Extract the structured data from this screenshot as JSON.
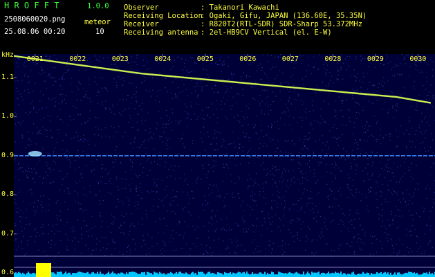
{
  "header": {
    "app_name": "H R O F F T",
    "version": "1.0.0",
    "filename": "2508060020.png",
    "meteor_label": "meteor",
    "datetime": "25.08.06 00:20",
    "meteor_count": "10",
    "labels": [
      "Observer",
      "Receiving Location",
      "Receiver",
      "Receiving antenna"
    ],
    "values": [
      ": Takanori Kawachi",
      ": Ogaki, Gifu, JAPAN (136.60E, 35.35N)",
      ": R820T2(RTL-SDR) SDR-Sharp 53.372MHz",
      ": 2el-HB9CV Vertical (el. E-W)"
    ]
  },
  "chart_data": {
    "type": "heatmap",
    "ylabel": "kHz",
    "x_ticks": [
      "0021",
      "0022",
      "0023",
      "0024",
      "0025",
      "0026",
      "0027",
      "0028",
      "0029",
      "0030"
    ],
    "y_ticks": [
      "1.1",
      "1.0",
      "0.9",
      "0.8",
      "0.7",
      "0.6"
    ],
    "y_tick_values": [
      1.1,
      1.0,
      0.9,
      0.8,
      0.7,
      0.6
    ],
    "ylim": [
      0.59,
      1.16
    ],
    "xlim": [
      20.5,
      30.4
    ],
    "signal_trace": {
      "x": [
        20.5,
        21.5,
        22.5,
        23.5,
        24.5,
        25.5,
        26.5,
        27.5,
        28.5,
        29.5,
        30.3
      ],
      "y": [
        1.155,
        1.14,
        1.125,
        1.11,
        1.1,
        1.09,
        1.08,
        1.07,
        1.06,
        1.05,
        1.035
      ]
    },
    "constant_line_y": 0.9,
    "meteor_echo": {
      "x": 21.0,
      "y": 0.905
    }
  },
  "colors": {
    "background": "#000038",
    "trace": "#c8f050",
    "constant_line": "#3c8cff",
    "noise": "#2a40a0",
    "histogram": "#00c8ff",
    "meteor_bar": "#ffff00",
    "tick_label": "#ffff40",
    "grid": "#7070c8"
  }
}
